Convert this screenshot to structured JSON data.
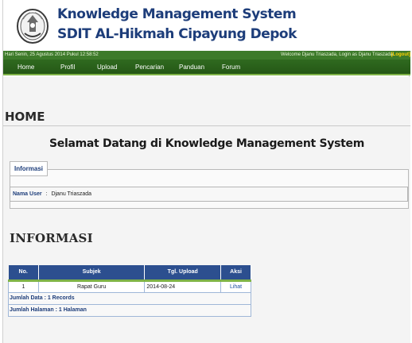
{
  "header": {
    "title_line1": "Knowledge Management System",
    "title_line2": "SDIT AL-Hikmah Cipayung Depok"
  },
  "statusbar": {
    "datetime": "Hari Senin, 25 Agustus 2014 Pukul 12:58:52",
    "welcome": "Welcome Djanu Triaszada, Login as Djanu Triaszada",
    "logout": "[Logout]"
  },
  "nav": {
    "items": [
      "Home",
      "Profil",
      "Upload",
      "Pencarian",
      "Panduan",
      "Forum"
    ]
  },
  "page": {
    "heading": "HOME",
    "welcome": "Selamat Datang di Knowledge Management System"
  },
  "info_panel": {
    "legend": "Informasi",
    "user_label": "Nama User",
    "user_separator": ":",
    "user_value": "Djanu Triaszada"
  },
  "informasi": {
    "heading": "INFORMASI",
    "columns": [
      "No.",
      "Subjek",
      "Tgl. Upload",
      "Aksi"
    ],
    "rows": [
      {
        "no": "1",
        "subjek": "Rapat Guru",
        "tgl": "2014-08-24",
        "aksi": "Lihat"
      }
    ],
    "jumlah_data": "Jumlah Data : 1 Records",
    "jumlah_halaman": "Jumlah Halaman : 1 Halaman"
  },
  "colors": {
    "nav_green": "#2f6a1f",
    "accent_green": "#7fb347",
    "table_header_blue": "#2c4f8f",
    "title_blue": "#1d3d7a"
  },
  "icons": {
    "logo": "school-emblem-icon"
  }
}
